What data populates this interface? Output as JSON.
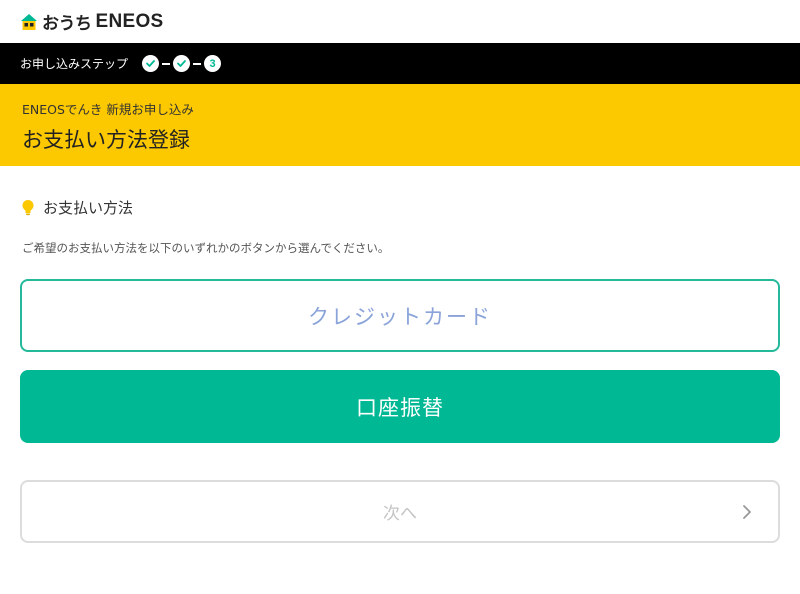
{
  "header": {
    "logo_hiragana": "おうち",
    "logo_brand": "ENEOS",
    "logo_icon": "house-icon"
  },
  "steps": {
    "label": "お申し込みステップ",
    "current_number": "3",
    "completed_icon": "check-icon",
    "accent": "#00b894"
  },
  "title": {
    "subtitle": "ENEOSでんき 新規お申し込み",
    "main": "お支払い方法登録",
    "background": "#fcc800"
  },
  "section": {
    "icon": "lightbulb-icon",
    "title": "お支払い方法",
    "description": "ご希望のお支払い方法を以下のいずれかのボタンから選んでください。"
  },
  "options": {
    "credit_card": "クレジットカード",
    "bank_transfer": "口座振替"
  },
  "next_button": {
    "label": "次へ",
    "icon": "chevron-right-icon"
  }
}
